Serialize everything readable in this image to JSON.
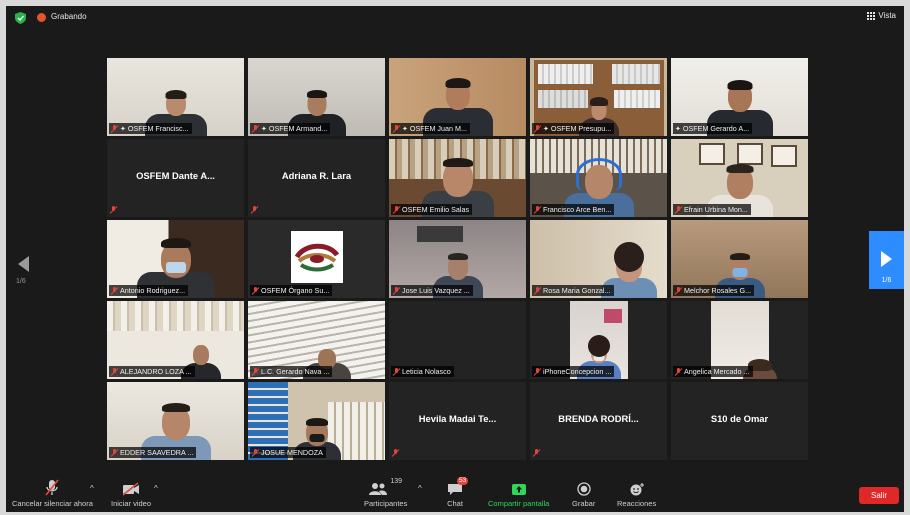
{
  "topbar": {
    "recording_label": "Grabando",
    "view_label": "Vista"
  },
  "pagination": {
    "prev_label": "1/6",
    "next_label": "1/6"
  },
  "participants": [
    {
      "name": "OSFEM Francisc...",
      "video": true,
      "muted": true,
      "pinned": true
    },
    {
      "name": "OSFEM Armand...",
      "video": true,
      "muted": true,
      "pinned": true
    },
    {
      "name": "OSFEM Juan M...",
      "video": true,
      "muted": true,
      "pinned": true
    },
    {
      "name": "OSFEM Presupu...",
      "video": true,
      "muted": true,
      "pinned": true
    },
    {
      "name": "OSFEM Gerardo A...",
      "video": true,
      "muted": false,
      "pinned": true,
      "active_speaker": true
    },
    {
      "name": "OSFEM Dante A...",
      "video": false,
      "muted": true
    },
    {
      "name": "Adriana R. Lara",
      "video": false,
      "muted": true
    },
    {
      "name": "OSFEM Emilio Salas",
      "video": true,
      "muted": true
    },
    {
      "name": "Francisco Arce Ben...",
      "video": true,
      "muted": true
    },
    {
      "name": "Efrain Urbina Mon...",
      "video": true,
      "muted": true
    },
    {
      "name": "Antonio Rodriguez...",
      "video": true,
      "muted": true
    },
    {
      "name": "OSFEM Órgano Su...",
      "video": true,
      "muted": true
    },
    {
      "name": "Jose Luis Vazquez ...",
      "video": true,
      "muted": true
    },
    {
      "name": "Rosa Maria Gonzal...",
      "video": true,
      "muted": true
    },
    {
      "name": "Melchor Rosales G...",
      "video": true,
      "muted": true
    },
    {
      "name": "ALEJANDRO LOZA ...",
      "video": true,
      "muted": true
    },
    {
      "name": "L.C. Gerardo Nava ...",
      "video": true,
      "muted": true
    },
    {
      "name": "Leticia Nolasco",
      "video": false,
      "muted": true,
      "label_only": true
    },
    {
      "name": "iPhoneConcepcion ...",
      "video": true,
      "muted": true
    },
    {
      "name": "Angelica Mercado ...",
      "video": true,
      "muted": true
    },
    {
      "name": "EDDER SAAVEDRA ...",
      "video": true,
      "muted": true
    },
    {
      "name": "JOSUE MENDOZA",
      "video": true,
      "muted": true
    },
    {
      "name": "Hevila Madai Te...",
      "video": false,
      "muted": true
    },
    {
      "name": "BRENDA RODRÍ...",
      "video": false,
      "muted": true
    },
    {
      "name": "S10 de Omar",
      "video": false,
      "muted": false
    }
  ],
  "toolbar": {
    "unmute_label": "Cancelar silenciar ahora",
    "start_video_label": "Iniciar video",
    "participants_label": "Participantes",
    "participants_count": "139",
    "chat_label": "Chat",
    "chat_badge": "53",
    "share_label": "Compartir pantalla",
    "record_label": "Grabar",
    "reactions_label": "Reacciones",
    "leave_label": "Salir"
  },
  "colors": {
    "share_green": "#2fd65a",
    "leave_red": "#e02828",
    "next_page_blue": "#2d8cff",
    "active_speaker_border": "#e6d94e"
  }
}
